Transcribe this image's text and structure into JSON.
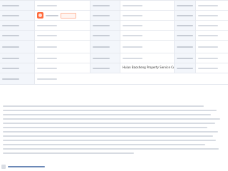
{
  "window": {
    "title": ""
  },
  "colors": {
    "label_background": "#f3f6fb",
    "border": "#e6e9ef",
    "accent": "#ff6b3d",
    "status": "#2e8b57",
    "link": "#6b88b7"
  },
  "company": {
    "english_name": "Huian Baosheng Property Service Co., Ltd."
  },
  "rows": [
    [
      {
        "kind": "label",
        "text": ""
      },
      {
        "kind": "value",
        "text": ""
      },
      {
        "kind": "label",
        "text": ""
      },
      {
        "kind": "value",
        "text": ""
      },
      {
        "kind": "label",
        "text": ""
      },
      {
        "kind": "value",
        "text": ""
      }
    ],
    [
      {
        "kind": "label",
        "text": ""
      },
      {
        "kind": "legal_rep",
        "name": "",
        "badge": ""
      },
      {
        "kind": "label",
        "text": ""
      },
      {
        "kind": "value",
        "text": ""
      },
      {
        "kind": "label",
        "text": ""
      },
      {
        "kind": "value",
        "text": ""
      }
    ],
    [
      {
        "kind": "label",
        "text": ""
      },
      {
        "kind": "value",
        "text": ""
      },
      {
        "kind": "label",
        "text": ""
      },
      {
        "kind": "value",
        "text": ""
      },
      {
        "kind": "label",
        "text": ""
      },
      {
        "kind": "value",
        "text": ""
      }
    ],
    [
      {
        "kind": "label",
        "text": ""
      },
      {
        "kind": "value",
        "text": ""
      },
      {
        "kind": "label",
        "text": ""
      },
      {
        "kind": "value",
        "text": ""
      },
      {
        "kind": "label",
        "text": ""
      },
      {
        "kind": "value",
        "text": ""
      }
    ],
    [
      {
        "kind": "label",
        "text": ""
      },
      {
        "kind": "value",
        "text": ""
      },
      {
        "kind": "label",
        "text": ""
      },
      {
        "kind": "value",
        "text": ""
      },
      {
        "kind": "label",
        "text": ""
      },
      {
        "kind": "value",
        "text": ""
      }
    ],
    [
      {
        "kind": "label",
        "text": ""
      },
      {
        "kind": "value",
        "text": ""
      },
      {
        "kind": "label",
        "text": ""
      },
      {
        "kind": "value",
        "text": ""
      },
      {
        "kind": "label",
        "text": ""
      },
      {
        "kind": "value",
        "text": ""
      }
    ],
    [
      {
        "kind": "label",
        "text": ""
      },
      {
        "kind": "value",
        "text": ""
      },
      {
        "kind": "label",
        "text": ""
      },
      {
        "kind": "english_name"
      },
      {
        "kind": "label",
        "text": ""
      },
      {
        "kind": "value",
        "text": ""
      }
    ],
    [
      {
        "kind": "label",
        "text": ""
      },
      {
        "kind": "value",
        "text": ""
      }
    ]
  ],
  "paragraph": {
    "lines": [
      "",
      "",
      "",
      "",
      "",
      "",
      "",
      "",
      "",
      "",
      "",
      ""
    ]
  },
  "bottom_link": {
    "text": ""
  }
}
